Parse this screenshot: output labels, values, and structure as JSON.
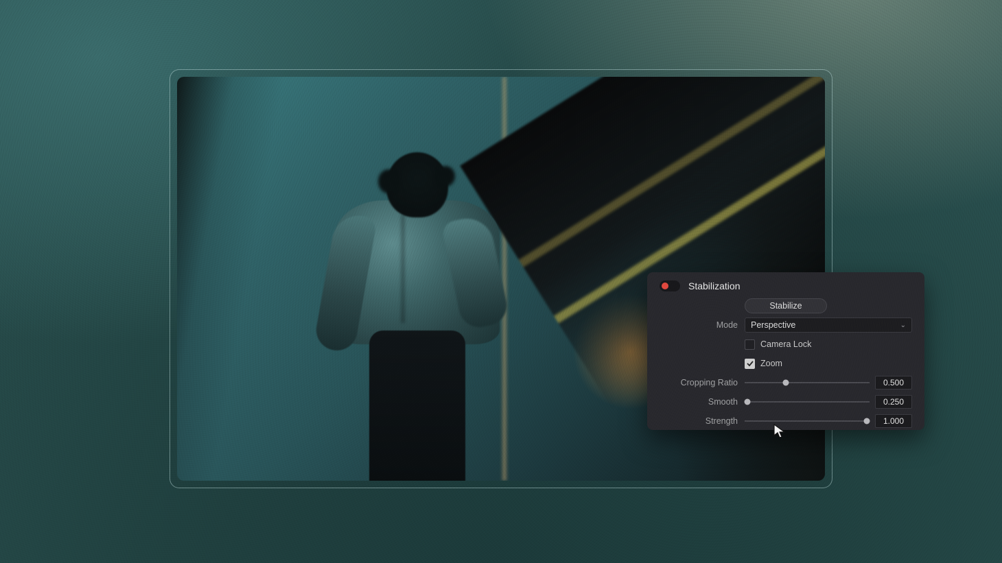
{
  "panel": {
    "title": "Stabilization",
    "toggle_on": false,
    "stabilize_button": "Stabilize",
    "mode": {
      "label": "Mode",
      "value": "Perspective"
    },
    "camera_lock": {
      "label": "Camera Lock",
      "checked": false
    },
    "zoom": {
      "label": "Zoom",
      "checked": true
    },
    "cropping_ratio": {
      "label": "Cropping Ratio",
      "value": "0.500",
      "position": 0.33
    },
    "smooth": {
      "label": "Smooth",
      "value": "0.250",
      "position": 0.02
    },
    "strength": {
      "label": "Strength",
      "value": "1.000",
      "position": 0.98
    }
  }
}
